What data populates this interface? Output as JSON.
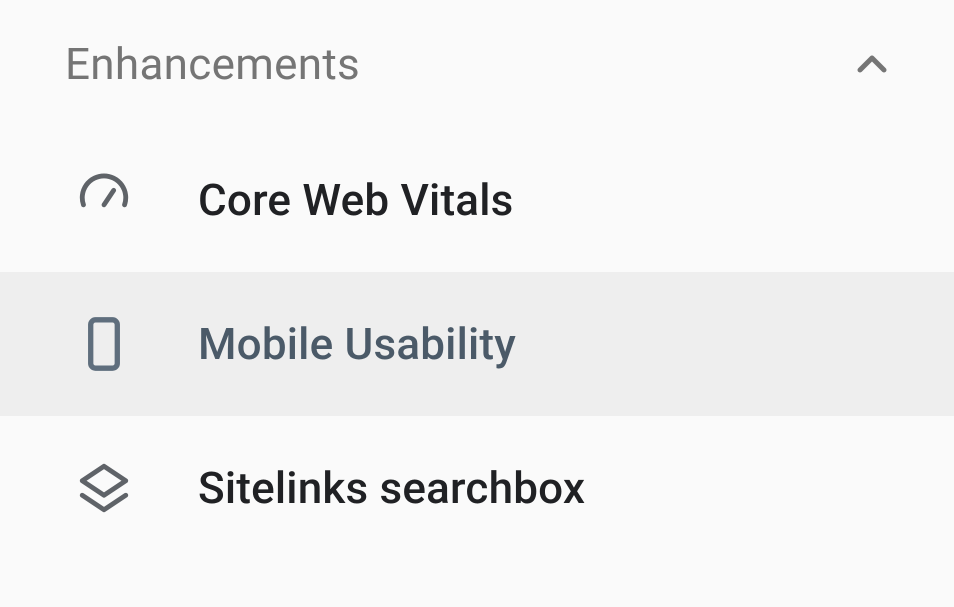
{
  "section": {
    "title": "Enhancements",
    "expanded": true
  },
  "items": [
    {
      "icon": "speedometer",
      "label": "Core Web Vitals",
      "selected": false
    },
    {
      "icon": "mobile",
      "label": "Mobile Usability",
      "selected": true
    },
    {
      "icon": "layers",
      "label": "Sitelinks searchbox",
      "selected": false
    }
  ]
}
